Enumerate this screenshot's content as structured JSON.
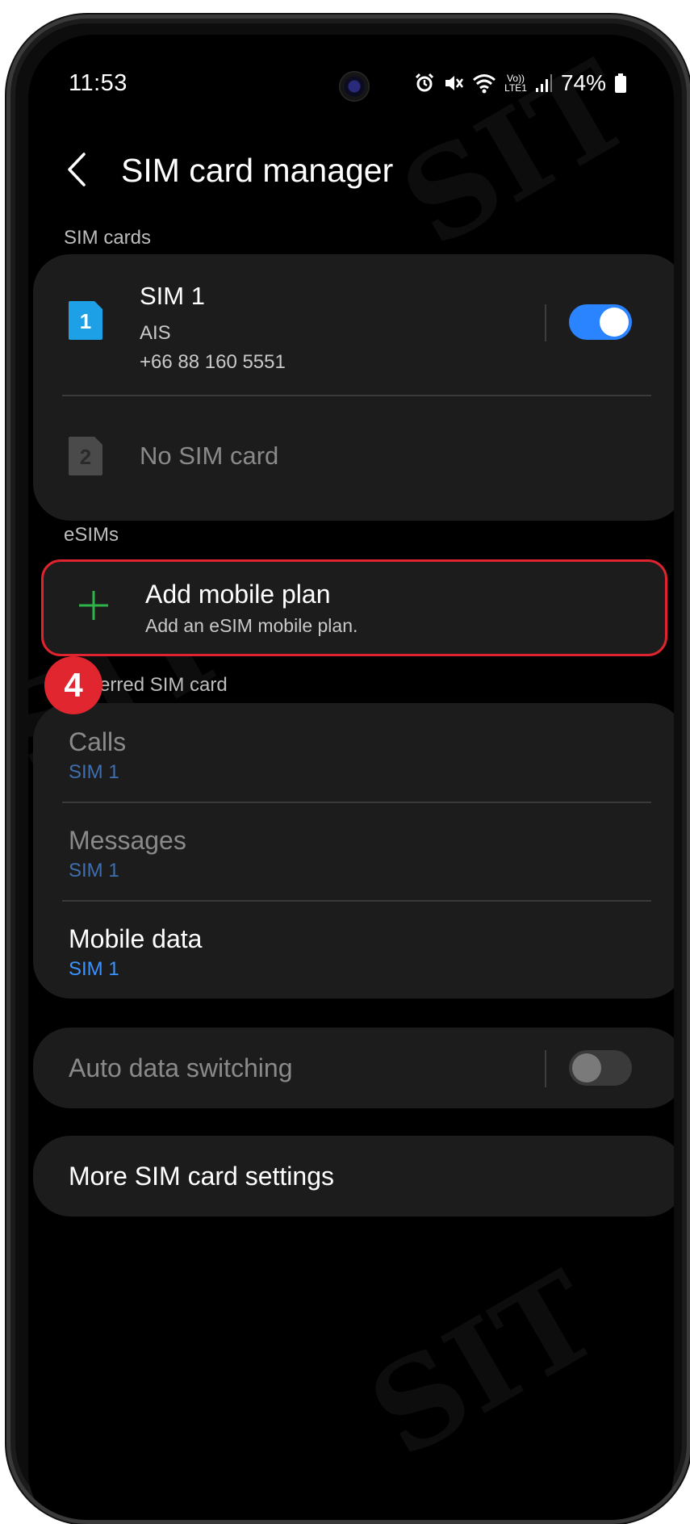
{
  "status_bar": {
    "time": "11:53",
    "lte_top": "Vo))",
    "lte_bottom": "LTE1",
    "battery": "74%"
  },
  "header": {
    "back_icon": "chevron-left-icon",
    "title": "SIM card manager"
  },
  "sim_cards": {
    "section_label": "SIM cards",
    "sim1": {
      "slot": "1",
      "name": "SIM 1",
      "carrier": "AIS",
      "number": "+66 88 160 5551",
      "enabled": true,
      "icon_color": "#1ea0e6"
    },
    "sim2": {
      "slot": "2",
      "name": "No SIM card"
    }
  },
  "esims": {
    "section_label": "eSIMs",
    "add_plan": {
      "title": "Add mobile plan",
      "subtitle": "Add an eSIM mobile plan.",
      "icon": "plus-icon",
      "icon_color": "#2fb44a",
      "highlight_color": "#e0242f"
    }
  },
  "step_badge": "4",
  "preferred": {
    "section_label": "Preferred SIM card",
    "calls": {
      "title": "Calls",
      "value": "SIM 1"
    },
    "messages": {
      "title": "Messages",
      "value": "SIM 1"
    },
    "mobile_data": {
      "title": "Mobile data",
      "value": "SIM 1"
    }
  },
  "auto_data_switching": {
    "title": "Auto data switching",
    "enabled": false
  },
  "more_settings": {
    "title": "More SIM card settings"
  },
  "colors": {
    "background": "#000000",
    "card": "#1c1c1c",
    "accent_blue": "#2a84ff"
  }
}
